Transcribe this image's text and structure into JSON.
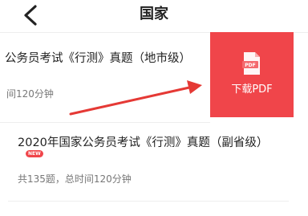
{
  "header": {
    "title": "国家",
    "back_icon": "chevron-left-icon"
  },
  "list": [
    {
      "title": "公务员考试《行测》真题（地市级）",
      "meta": "间120分钟",
      "action": {
        "icon": "pdf-file-icon",
        "icon_text": "PDF",
        "label": "下载PDF",
        "color": "#f0454a"
      }
    },
    {
      "title": "2020年国家公务员考试《行测》真题（副省级）",
      "badge": "NEW",
      "meta": "共135题，总时间120分钟"
    }
  ],
  "annotation": {
    "type": "arrow",
    "color": "#e53935"
  }
}
